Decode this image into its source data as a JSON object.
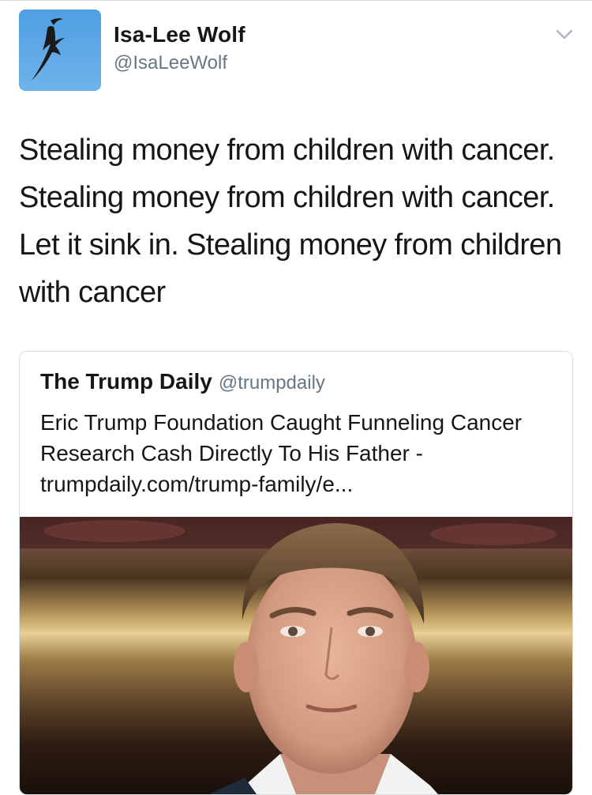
{
  "tweet": {
    "author": {
      "display_name": "Isa-Lee Wolf",
      "handle": "@IsaLeeWolf",
      "avatar_icon": "seagull-avatar"
    },
    "menu_icon": "chevron-down-icon",
    "text": "Stealing money from children with cancer. Stealing money from children with cancer. Let it sink in. Stealing money from children with cancer"
  },
  "quoted": {
    "author_name": "The Trump Daily",
    "author_handle": "@trumpdaily",
    "text": "Eric Trump Foundation Caught Funneling Cancer Research Cash Directly To His Father -",
    "link": "trumpdaily.com/trump-family/e...",
    "image_icon": "person-photo"
  },
  "colors": {
    "text_primary": "#14171a",
    "text_secondary": "#657786",
    "border": "#d8dde1",
    "avatar_sky": "#5ba7e6"
  }
}
